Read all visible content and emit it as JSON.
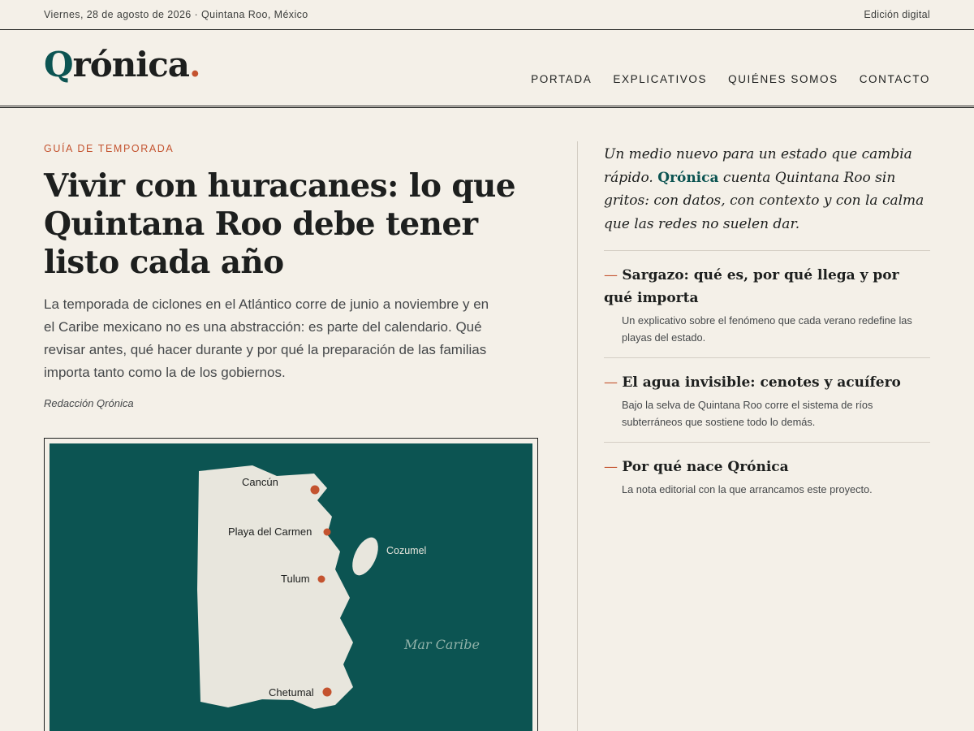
{
  "topbar": {
    "date": "Viernes, 28 de agosto de 2026 · Quintana Roo, México",
    "edition": "Edición digital"
  },
  "masthead": {
    "logo_q": "Q",
    "logo_rest": "rónica",
    "logo_dot": ".",
    "nav": [
      "PORTADA",
      "EXPLICATIVOS",
      "QUIÉNES SOMOS",
      "CONTACTO"
    ]
  },
  "article": {
    "kicker": "GUÍA DE TEMPORADA",
    "headline": "Vivir con huracanes: lo que Quintana Roo debe tener listo cada año",
    "dek": "La temporada de ciclones en el Atlántico corre de junio a noviembre y en el Caribe mexicano no es una abstracción: es parte del calendario. Qué revisar antes, qué hacer durante y por qué la preparación de las familias importa tanto como la de los gobiernos.",
    "byline": "Redacción Qrónica"
  },
  "map": {
    "cities": [
      "Cancún",
      "Playa del Carmen",
      "Tulum",
      "Chetumal"
    ],
    "island": "Cozumel",
    "sea": "Mar Caribe"
  },
  "sidebar": {
    "intro_before": "Un medio nuevo para un estado que cambia rápido. ",
    "intro_brand": "Qrónica",
    "intro_after": " cuenta Quintana Roo sin gritos: con datos, con contexto y con la calma que las redes no suelen dar.",
    "items": [
      {
        "title": "Sargazo: qué es, por qué llega y por qué importa",
        "desc": "Un explicativo sobre el fenómeno que cada verano redefine las playas del estado."
      },
      {
        "title": "El agua invisible: cenotes y acuífero",
        "desc": "Bajo la selva de Quintana Roo corre el sistema de ríos subterráneos que sostiene todo lo demás."
      },
      {
        "title": "Por qué nace Qrónica",
        "desc": "La nota editorial con la que arrancamos este proyecto."
      }
    ]
  },
  "colors": {
    "background": "#f4f0e8",
    "accent": "#c4532f",
    "brand_teal": "#0c5452",
    "land": "#e8e6dd"
  }
}
